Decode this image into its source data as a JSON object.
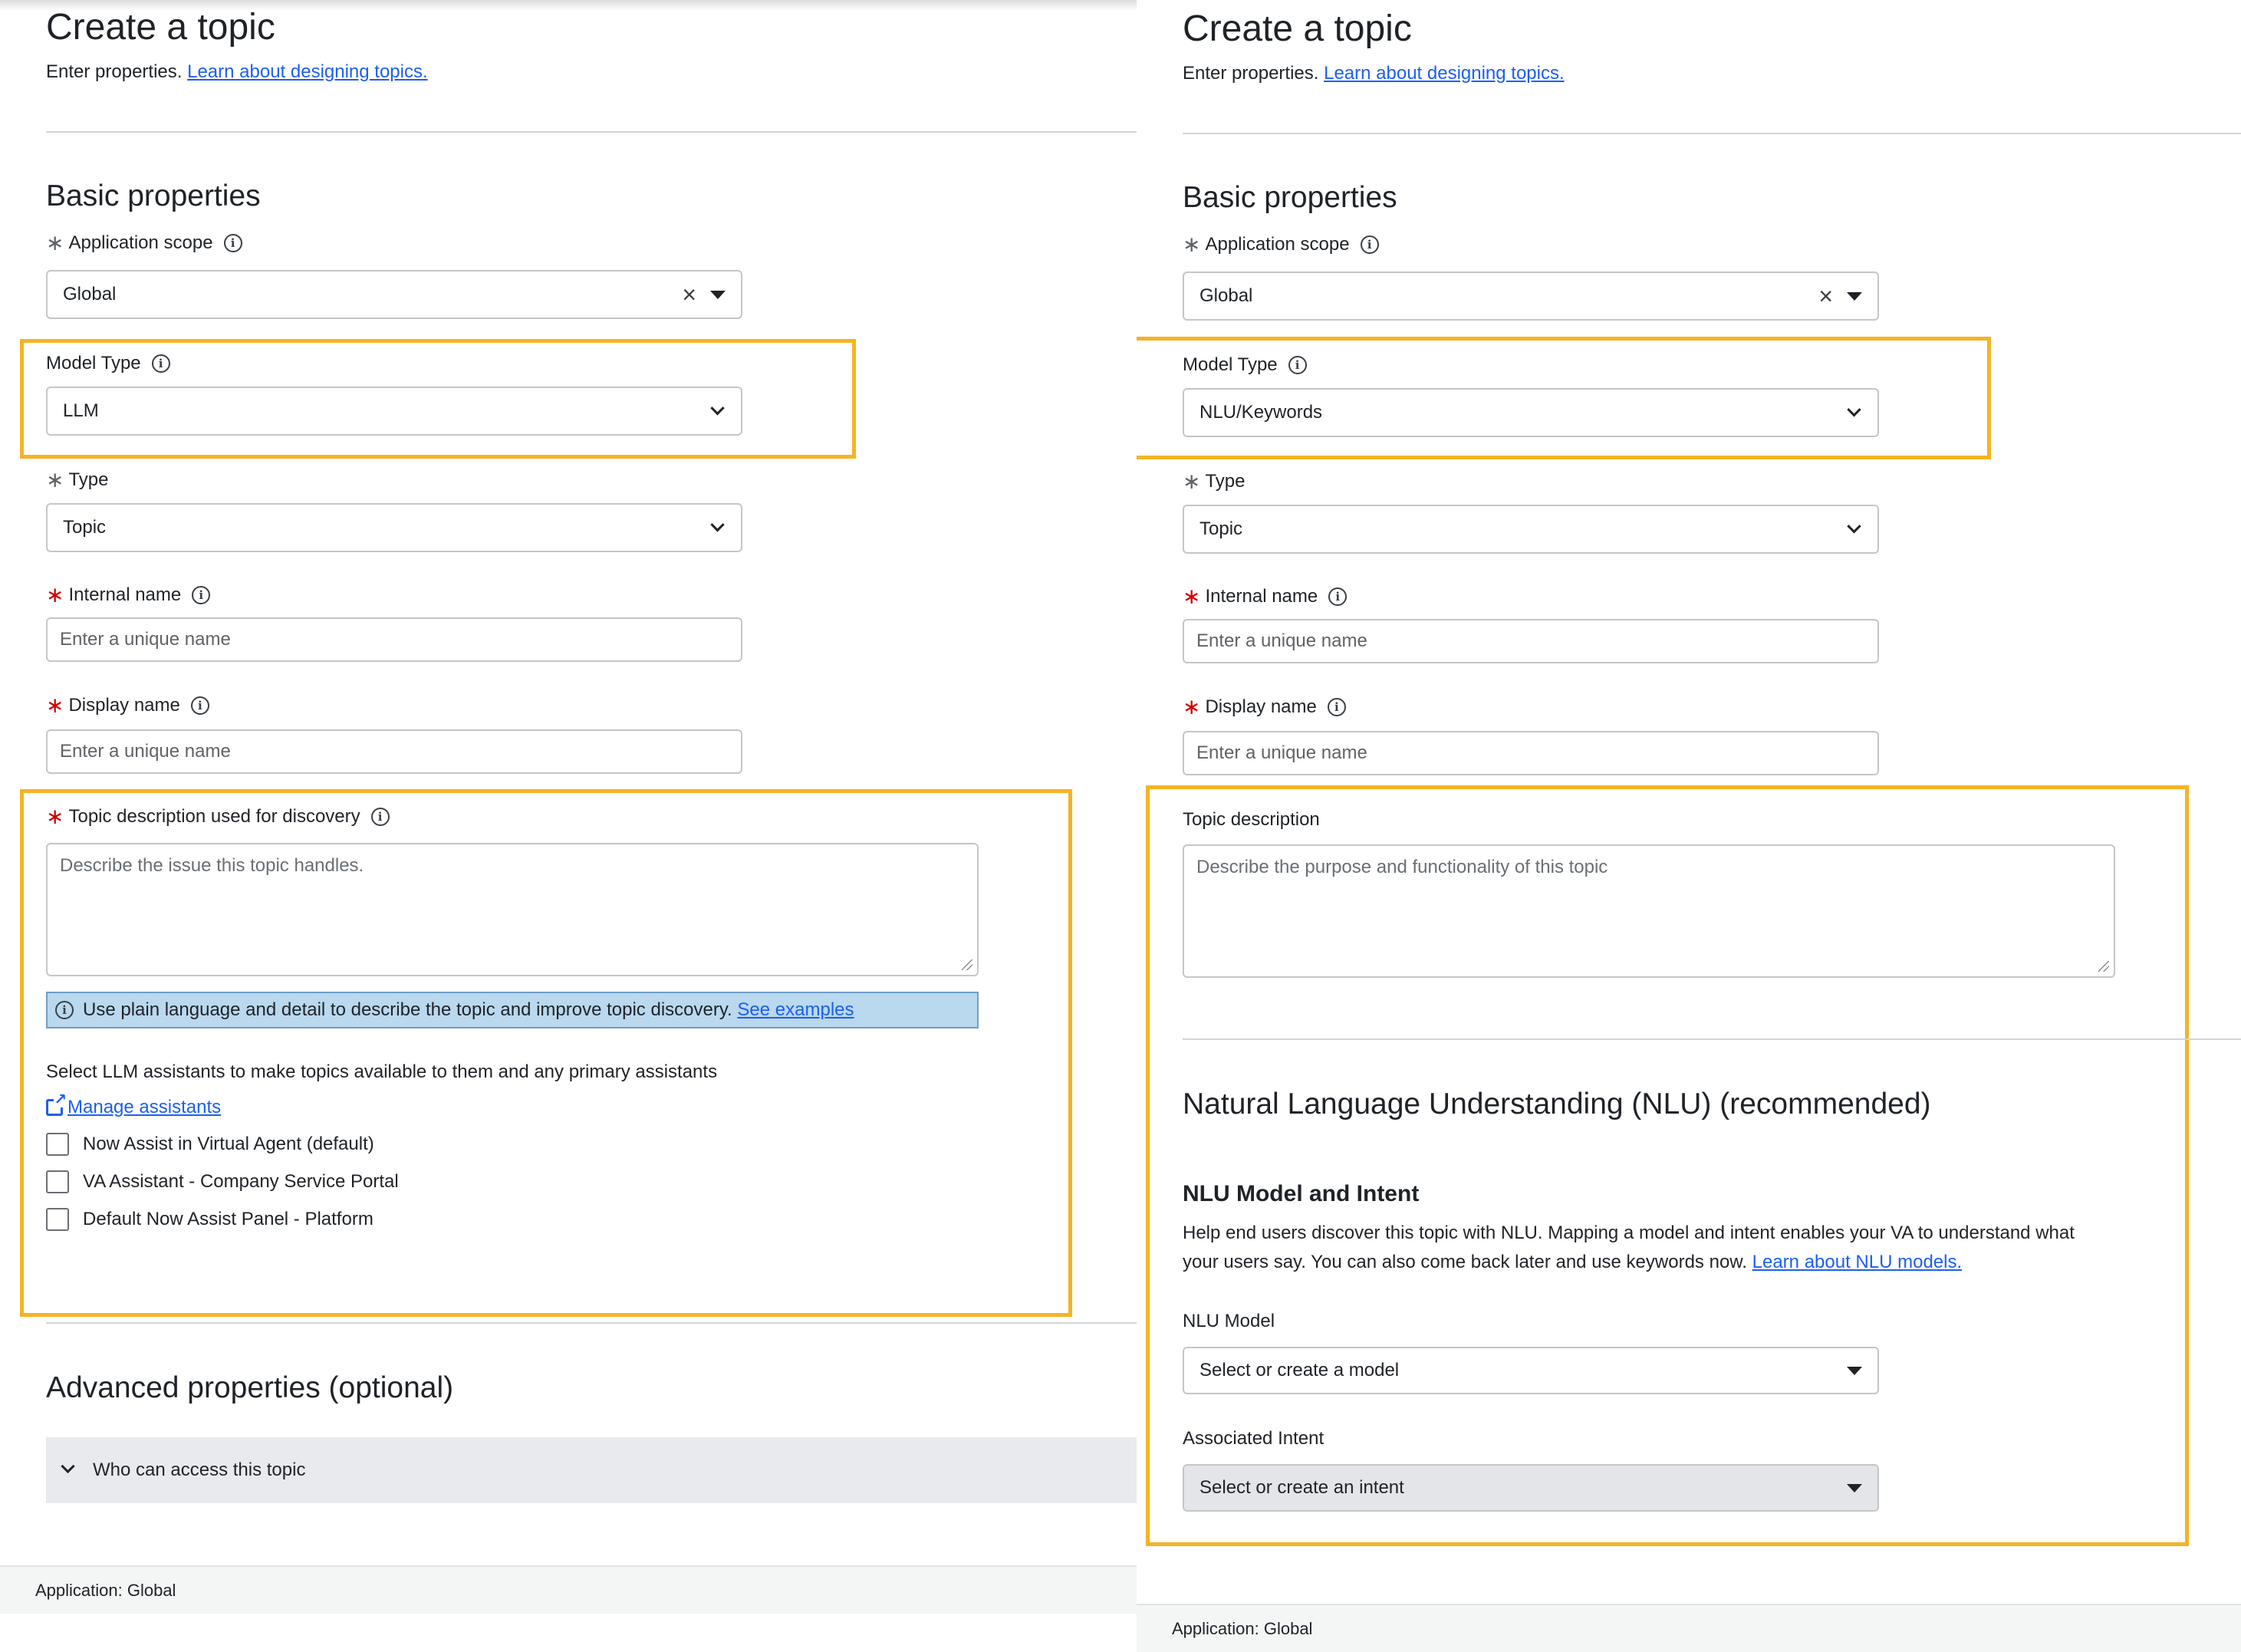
{
  "left": {
    "title": "Create a topic",
    "intro_text": "Enter properties.",
    "intro_link": "Learn about designing topics.",
    "basic_title": "Basic properties",
    "app_scope_label": "Application scope",
    "app_scope_value": "Global",
    "model_type_label": "Model Type",
    "model_type_value": "LLM",
    "type_label": "Type",
    "type_value": "Topic",
    "internal_name_label": "Internal name",
    "internal_name_placeholder": "Enter a unique name",
    "display_name_label": "Display name",
    "display_name_placeholder": "Enter a unique name",
    "description_label": "Topic description used for discovery",
    "description_placeholder": "Describe the issue this topic handles.",
    "hint_text": "Use plain language and detail to describe the topic and improve topic discovery.",
    "hint_link": "See examples",
    "assistants_text": "Select LLM assistants to make topics available to them and any primary assistants",
    "manage_link": "Manage assistants",
    "assistants": [
      "Now Assist in Virtual Agent (default)",
      "VA Assistant - Company Service Portal",
      "Default Now Assist Panel - Platform"
    ],
    "advanced_title": "Advanced properties (optional)",
    "accordion_label": "Who can access this topic",
    "footer": "Application: Global"
  },
  "right": {
    "title": "Create a topic",
    "intro_text": "Enter properties.",
    "intro_link": "Learn about designing topics.",
    "basic_title": "Basic properties",
    "app_scope_label": "Application scope",
    "app_scope_value": "Global",
    "model_type_label": "Model Type",
    "model_type_value": "NLU/Keywords",
    "type_label": "Type",
    "type_value": "Topic",
    "internal_name_label": "Internal name",
    "internal_name_placeholder": "Enter a unique name",
    "display_name_label": "Display name",
    "display_name_placeholder": "Enter a unique name",
    "description_label": "Topic description",
    "description_placeholder": "Describe the purpose and functionality of this topic",
    "nlu_title": "Natural Language Understanding (NLU) (recommended)",
    "nlu_sub_title": "NLU Model and Intent",
    "nlu_help": "Help end users discover this topic with NLU. Mapping a model and intent enables your VA to understand what your users say. You can also come back later and use keywords now.",
    "nlu_link": "Learn about NLU models.",
    "nlu_model_label": "NLU Model",
    "nlu_model_placeholder": "Select or create a model",
    "intent_label": "Associated Intent",
    "intent_placeholder": "Select or create an intent",
    "footer": "Application: Global"
  },
  "colors": {
    "highlight": "#f5b325",
    "link": "#1c5ff0",
    "required": "#d40000",
    "hint_bg": "#bad8ee"
  },
  "icons": [
    "info-icon",
    "clear-icon",
    "caret-down-icon",
    "chevron-down-icon",
    "external-link-icon",
    "resize-handle-icon"
  ]
}
